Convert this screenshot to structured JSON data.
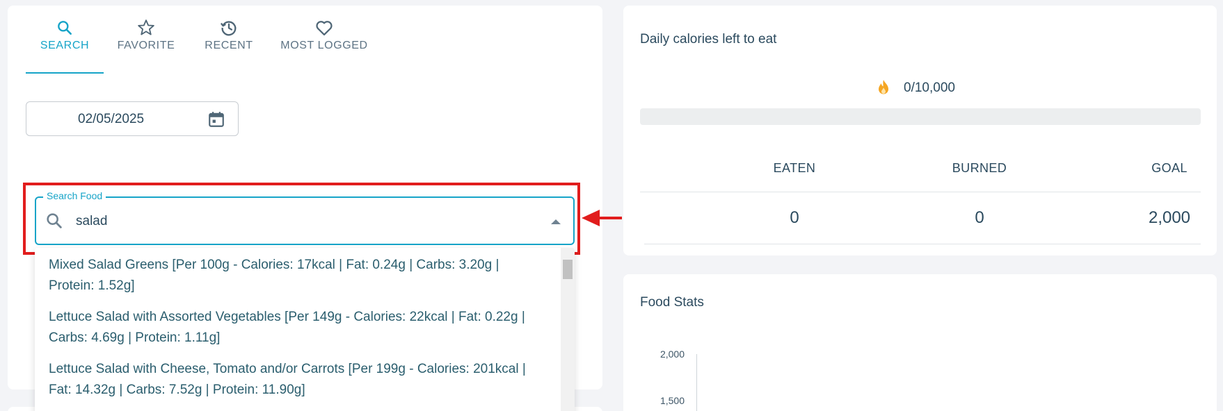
{
  "tabs": [
    {
      "label": "SEARCH",
      "icon": "search-icon"
    },
    {
      "label": "FAVORITE",
      "icon": "star-icon"
    },
    {
      "label": "RECENT",
      "icon": "history-icon"
    },
    {
      "label": "MOST LOGGED",
      "icon": "heart-icon"
    }
  ],
  "active_tab": "SEARCH",
  "date": {
    "value": "02/05/2025",
    "icon": "calendar-icon"
  },
  "search": {
    "label": "Search Food",
    "value": "salad",
    "icon": "search-icon",
    "toggle_icon": "caret-up-icon"
  },
  "suggestions": [
    "Mixed Salad Greens [Per 100g - Calories: 17kcal | Fat: 0.24g | Carbs: 3.20g | Protein: 1.52g]",
    "Lettuce Salad with Assorted Vegetables [Per 149g - Calories: 22kcal | Fat: 0.22g | Carbs: 4.69g | Protein: 1.11g]",
    "Lettuce Salad with Cheese, Tomato and/or Carrots [Per 199g - Calories: 201kcal | Fat: 14.32g | Carbs: 7.52g | Protein: 11.90g]"
  ],
  "calories": {
    "title": "Daily calories left to eat",
    "value": "0/10,000",
    "icon": "fire-icon",
    "progress": 0,
    "columns": [
      {
        "label": "EATEN",
        "value": "0"
      },
      {
        "label": "BURNED",
        "value": "0"
      },
      {
        "label": "GOAL",
        "value": "2,000"
      }
    ]
  },
  "food_stats": {
    "title": "Food Stats",
    "y_ticks": [
      "2,000",
      "1,500"
    ]
  },
  "colors": {
    "accent": "#16a4c8",
    "highlight": "#e11d1d",
    "fire": "#f5a623"
  }
}
